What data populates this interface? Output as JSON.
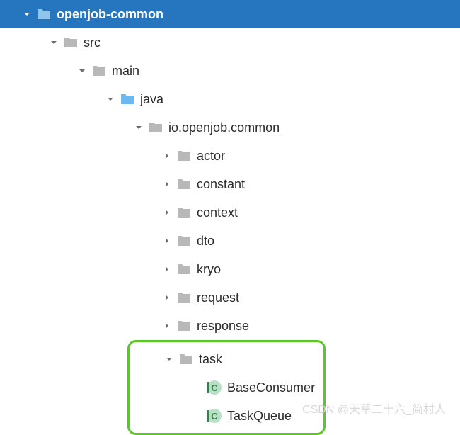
{
  "tree": {
    "root": {
      "label": "openjob-common",
      "expanded": true,
      "icon": "folder-module",
      "color": "#5da9e8"
    },
    "src": {
      "label": "src",
      "expanded": true,
      "icon": "folder",
      "color": "#b8b8b8"
    },
    "main": {
      "label": "main",
      "expanded": true,
      "icon": "folder",
      "color": "#b8b8b8"
    },
    "java": {
      "label": "java",
      "expanded": true,
      "icon": "folder",
      "color": "#6cb8f0"
    },
    "package": {
      "label": "io.openjob.common",
      "expanded": true,
      "icon": "folder",
      "color": "#b8b8b8"
    },
    "actor": {
      "label": "actor",
      "expanded": false,
      "icon": "folder",
      "color": "#b8b8b8"
    },
    "constant": {
      "label": "constant",
      "expanded": false,
      "icon": "folder",
      "color": "#b8b8b8"
    },
    "context": {
      "label": "context",
      "expanded": false,
      "icon": "folder",
      "color": "#b8b8b8"
    },
    "dto": {
      "label": "dto",
      "expanded": false,
      "icon": "folder",
      "color": "#b8b8b8"
    },
    "kryo": {
      "label": "kryo",
      "expanded": false,
      "icon": "folder",
      "color": "#b8b8b8"
    },
    "request": {
      "label": "request",
      "expanded": false,
      "icon": "folder",
      "color": "#b8b8b8"
    },
    "response": {
      "label": "response",
      "expanded": false,
      "icon": "folder",
      "color": "#b8b8b8"
    },
    "task": {
      "label": "task",
      "expanded": true,
      "icon": "folder",
      "color": "#b8b8b8"
    },
    "baseConsumer": {
      "label": "BaseConsumer",
      "icon": "class"
    },
    "taskQueue": {
      "label": "TaskQueue",
      "icon": "class"
    }
  },
  "watermark": "CSDN @天草二十六_简村人"
}
